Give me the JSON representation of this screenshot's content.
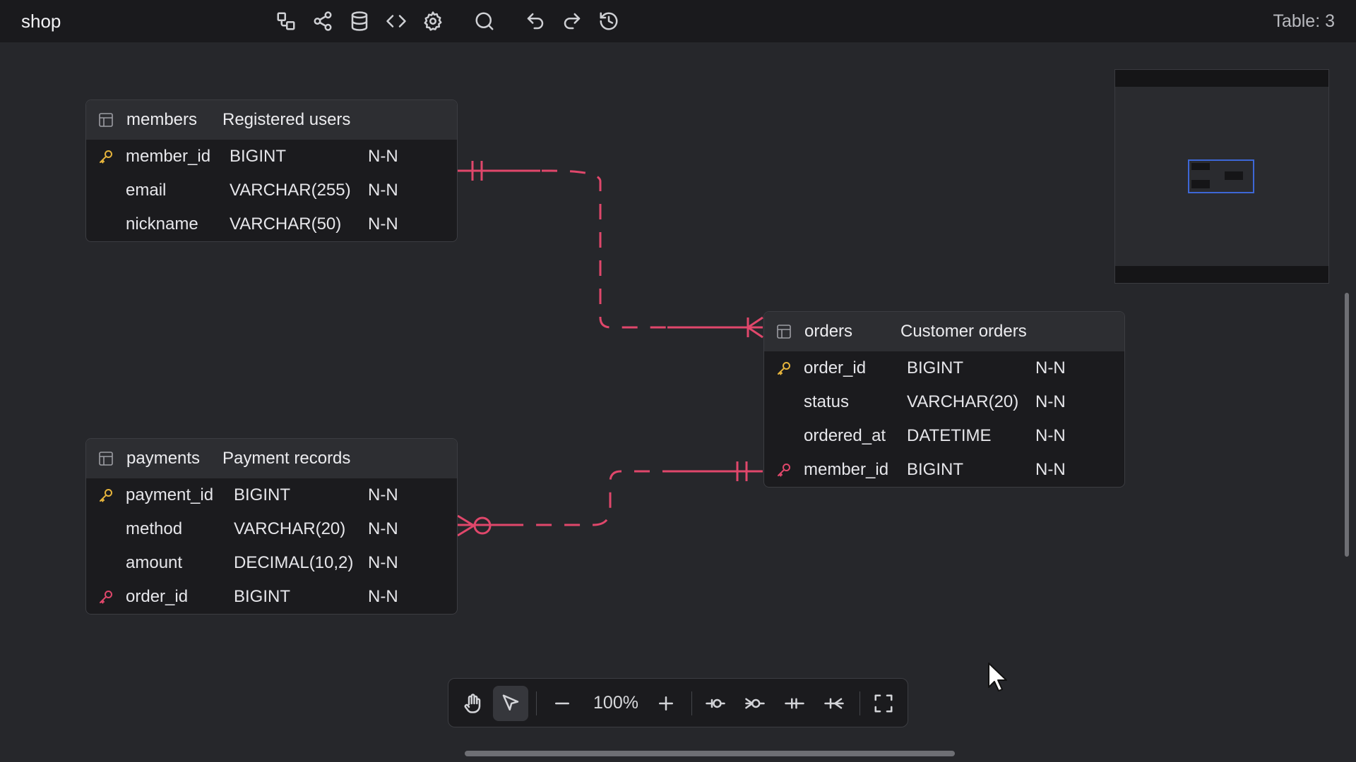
{
  "app": {
    "title": "shop",
    "table_count": "Table: 3"
  },
  "toolbar_top": {
    "icons": [
      "diagram-icon",
      "share-icon",
      "database-icon",
      "code-icon",
      "gear-icon",
      "search-icon",
      "undo-icon",
      "redo-icon",
      "history-icon"
    ]
  },
  "tables": {
    "members": {
      "name": "members",
      "comment": "Registered users",
      "columns": [
        {
          "name": "member_id",
          "type": "BIGINT",
          "null": "N-N",
          "key": "pk"
        },
        {
          "name": "email",
          "type": "VARCHAR(255)",
          "null": "N-N",
          "key": ""
        },
        {
          "name": "nickname",
          "type": "VARCHAR(50)",
          "null": "N-N",
          "key": ""
        }
      ]
    },
    "orders": {
      "name": "orders",
      "comment": "Customer orders",
      "columns": [
        {
          "name": "order_id",
          "type": "BIGINT",
          "null": "N-N",
          "key": "pk"
        },
        {
          "name": "status",
          "type": "VARCHAR(20)",
          "null": "N-N",
          "key": ""
        },
        {
          "name": "ordered_at",
          "type": "DATETIME",
          "null": "N-N",
          "key": ""
        },
        {
          "name": "member_id",
          "type": "BIGINT",
          "null": "N-N",
          "key": "fk"
        }
      ]
    },
    "payments": {
      "name": "payments",
      "comment": "Payment records",
      "columns": [
        {
          "name": "payment_id",
          "type": "BIGINT",
          "null": "N-N",
          "key": "pk"
        },
        {
          "name": "method",
          "type": "VARCHAR(20)",
          "null": "N-N",
          "key": ""
        },
        {
          "name": "amount",
          "type": "DECIMAL(10,2)",
          "null": "N-N",
          "key": ""
        },
        {
          "name": "order_id",
          "type": "BIGINT",
          "null": "N-N",
          "key": "fk"
        }
      ]
    }
  },
  "relations": [
    {
      "from": "members.member_id",
      "to": "orders.member_id",
      "cardinality": "one-to-many"
    },
    {
      "from": "orders.order_id",
      "to": "payments.order_id",
      "cardinality": "one-to-zero-or-many"
    }
  ],
  "colors": {
    "relation": "#e0476b",
    "pk": "#e6b43c",
    "fk": "#e0476b",
    "minimap_viewport": "#3d67d6"
  },
  "bottom_toolbar": {
    "zoom": "100%"
  }
}
